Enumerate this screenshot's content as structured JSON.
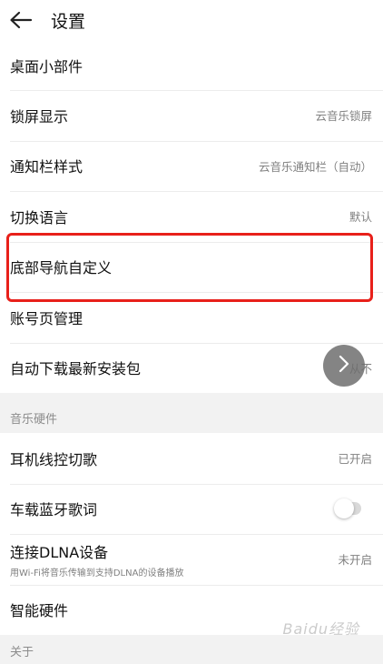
{
  "header": {
    "title": "设置",
    "back_icon": "arrow-left-icon"
  },
  "general_items": [
    {
      "label": "桌面小部件",
      "value": ""
    },
    {
      "label": "锁屏显示",
      "value": "云音乐锁屏"
    },
    {
      "label": "通知栏样式",
      "value": "云音乐通知栏（自动）"
    },
    {
      "label": "切换语言",
      "value": "默认"
    },
    {
      "label": "底部导航自定义",
      "value": ""
    },
    {
      "label": "账号页管理",
      "value": ""
    },
    {
      "label": "自动下载最新安装包",
      "value": "从不"
    }
  ],
  "hardware": {
    "section_title": "音乐硬件",
    "items": [
      {
        "label": "耳机线控切歌",
        "value": "已开启"
      },
      {
        "label": "车载蓝牙歌词",
        "toggle": false
      },
      {
        "label": "连接DLNA设备",
        "sub": "用Wi-Fi将音乐传输到支持DLNA的设备播放",
        "value": "未开启"
      },
      {
        "label": "智能硬件",
        "value": ""
      }
    ]
  },
  "about_section_title": "关于",
  "watermark": "Baidu经验",
  "colors": {
    "highlight": "#e8201a",
    "fab": "#6e6e6e"
  }
}
